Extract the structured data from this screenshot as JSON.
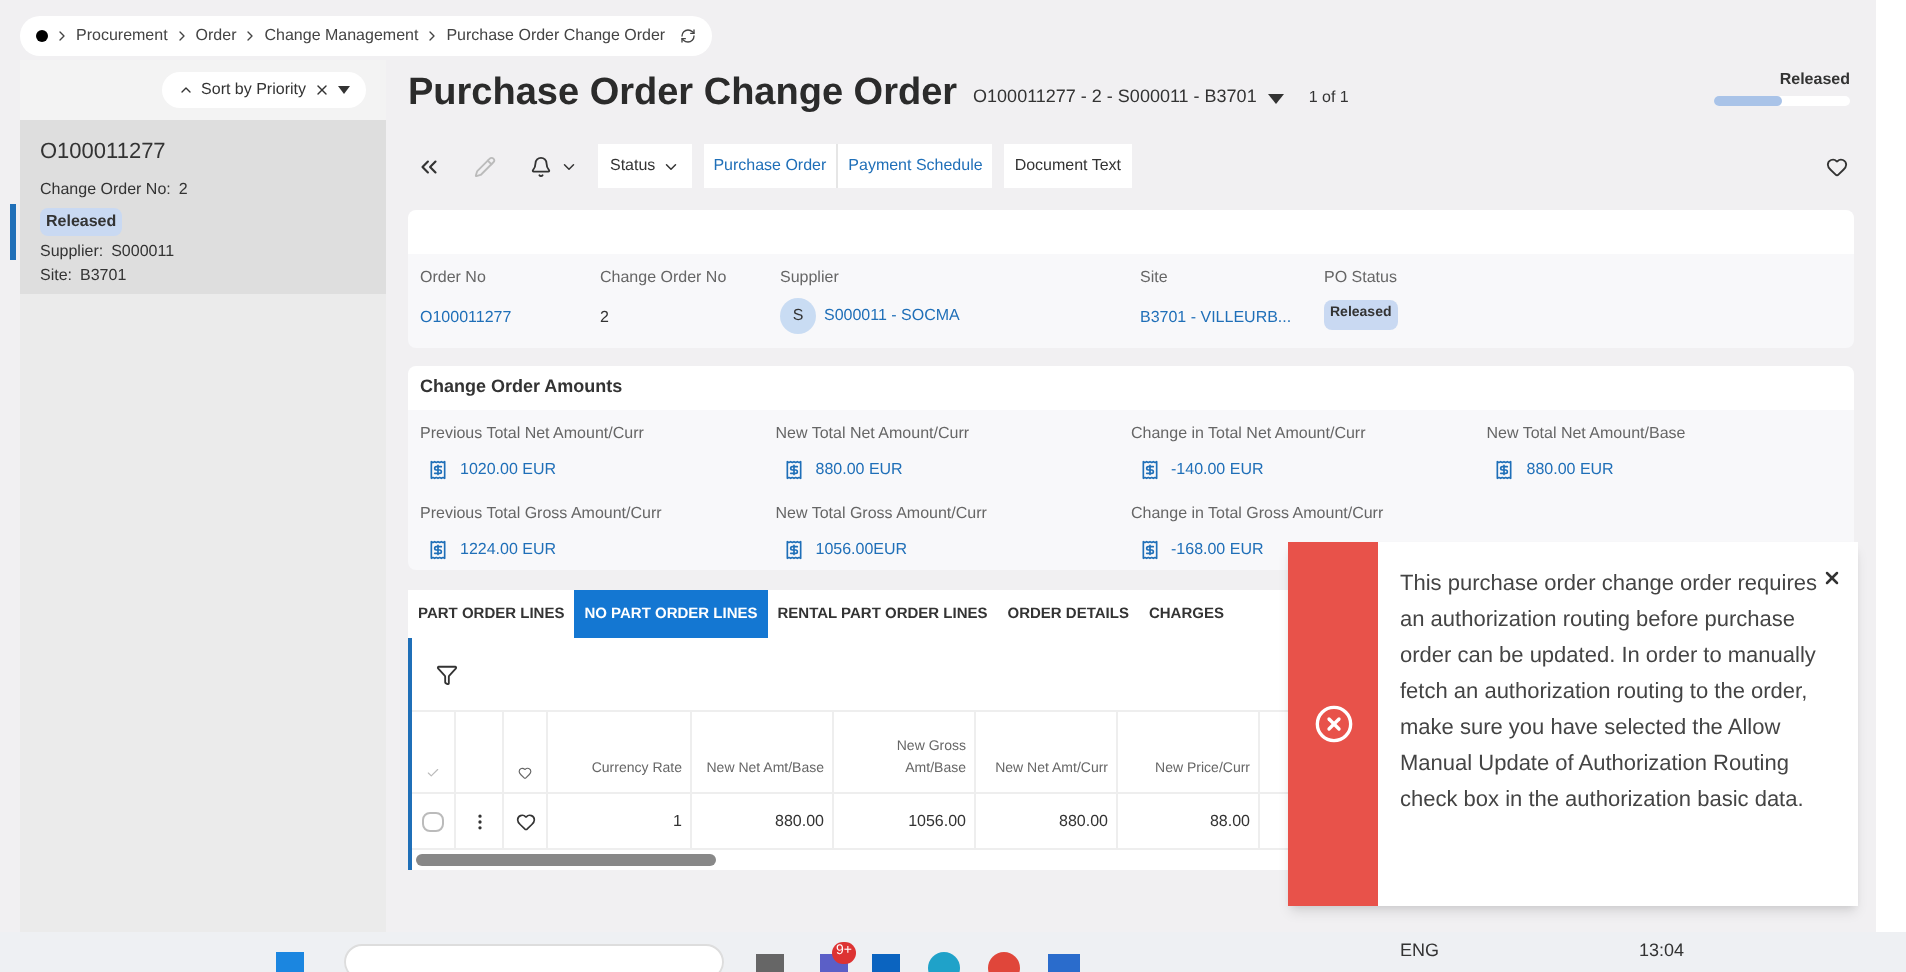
{
  "breadcrumb": [
    "Procurement",
    "Order",
    "Change Management",
    "Purchase Order Change Order"
  ],
  "sidebar": {
    "sort": "Sort by Priority",
    "items": [
      {
        "title": "O100011277",
        "change_label": "Change Order No:",
        "change_value": "2",
        "status": "Released",
        "supplier_label": "Supplier:",
        "supplier_value": "S000011",
        "site_label": "Site:",
        "site_value": "B3701",
        "selected": true
      }
    ]
  },
  "header": {
    "title": "Purchase Order Change Order",
    "record": "O100011277 - 2 - S000011 - B3701",
    "count": "1 of 1",
    "state": "Released",
    "level": 0.5
  },
  "toolbar": {
    "status": "Status",
    "links": [
      "Purchase Order",
      "Payment Schedule"
    ],
    "button": "Document Text"
  },
  "summary": {
    "fields": [
      {
        "label": "Order No",
        "value": "O100011277",
        "kind": "link"
      },
      {
        "label": "Change Order No",
        "value": "2",
        "kind": "plain"
      },
      {
        "label": "Supplier",
        "value": "S000011 - SOCMA",
        "kind": "avatar",
        "avatar": "S"
      },
      {
        "label": "Site",
        "value": "B3701 - VILLEURB...",
        "kind": "link"
      },
      {
        "label": "PO Status",
        "value": "Released",
        "kind": "badge"
      }
    ]
  },
  "amounts": {
    "title": "Change Order Amounts",
    "fields": [
      {
        "label": "Previous Total Net Amount/Curr",
        "value": "1020.00 EUR"
      },
      {
        "label": "New Total Net Amount/Curr",
        "value": "880.00 EUR"
      },
      {
        "label": "Change in Total Net Amount/Curr",
        "value": "-140.00 EUR"
      },
      {
        "label": "New Total Net Amount/Base",
        "value": "880.00 EUR"
      },
      {
        "label": "Previous Total Gross Amount/Curr",
        "value": "1224.00 EUR"
      },
      {
        "label": "New Total Gross Amount/Curr",
        "value": "1056.00EUR"
      },
      {
        "label": "Change in Total Gross Amount/Curr",
        "value": "-168.00 EUR"
      }
    ]
  },
  "tabs": [
    {
      "label": "PART ORDER LINES",
      "selected": false
    },
    {
      "label": "NO PART ORDER LINES",
      "selected": true
    },
    {
      "label": "RENTAL PART ORDER LINES",
      "selected": false
    },
    {
      "label": "ORDER DETAILS",
      "selected": false
    },
    {
      "label": "CHARGES",
      "selected": false
    }
  ],
  "table": {
    "columns": [
      "Currency Rate",
      "New Net Amt/Base",
      "New Gross Amt/Base",
      "New Net Amt/Curr",
      "New Price/Curr"
    ],
    "rows": [
      {
        "checked": false,
        "cells": [
          "1",
          "880.00",
          "1056.00",
          "880.00",
          "88.00"
        ]
      }
    ]
  },
  "toast": {
    "message": "This purchase order change order requires an authorization routing before purchase order can be updated. In order to manually fetch an authorization routing to the order, make sure you have selected the Allow Manual Update of Authorization Routing check box in the authorization basic data."
  },
  "taskbar": {
    "badge": "9+",
    "language": "ENG",
    "time": "13:04"
  }
}
